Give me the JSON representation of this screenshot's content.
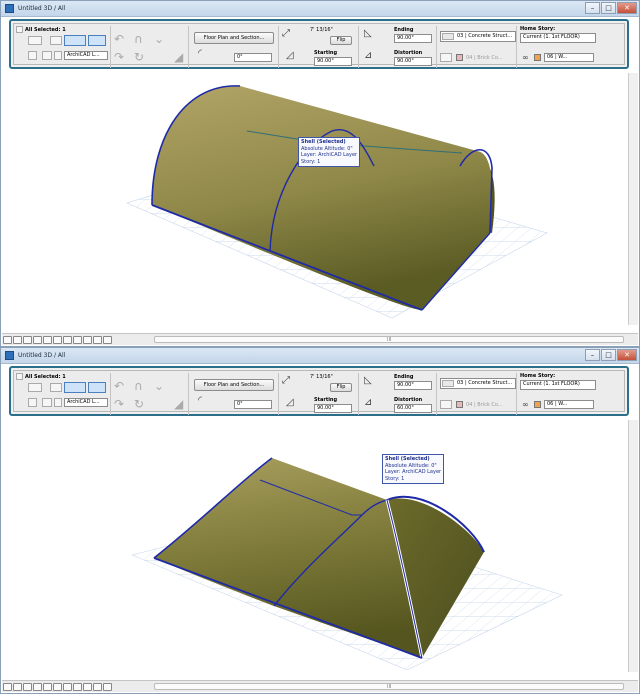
{
  "windows": [
    {
      "title": "Untitled 3D / All",
      "controls": {
        "minimize": "–",
        "maximize": "□",
        "close": "✕"
      },
      "infobox": {
        "selection_label": "All Selected: 1",
        "layer_value": "ArchiCAD L...",
        "plan_button": "Floor Plan and Section...",
        "angle_value": "0°",
        "thickness_value": "7' 13/16\"",
        "flip_button": "Flip",
        "starting_label": "Starting",
        "starting_value": "90.00°",
        "ending_label": "Ending",
        "ending_value": "90.00°",
        "distortion_label": "Distortion",
        "distortion_value": "90.00°",
        "composite": "03 | Concrete Struct...",
        "material": "04 | Brick Co...",
        "material_disabled": true,
        "home_story_label": "Home Story:",
        "home_story_value": "Current (1. 1st FLOOR)",
        "surface": "06 | W..."
      },
      "tooltip": {
        "title": "Shell (Selected)",
        "lines": [
          "Absolute Altitude: 0\"",
          "Layer: ArchiCAD Layer",
          "Story: 1"
        ]
      },
      "scroll_marker": "III"
    },
    {
      "title": "Untitled 3D / All",
      "controls": {
        "minimize": "–",
        "maximize": "□",
        "close": "✕"
      },
      "infobox": {
        "selection_label": "All Selected: 1",
        "layer_value": "ArchiCAD L...",
        "plan_button": "Floor Plan and Section...",
        "angle_value": "0°",
        "thickness_value": "7' 13/16\"",
        "flip_button": "Flip",
        "starting_label": "Starting",
        "starting_value": "90.00°",
        "ending_label": "Ending",
        "ending_value": "90.00°",
        "distortion_label": "Distortion",
        "distortion_value": "60.00°",
        "composite": "03 | Concrete Struct...",
        "material": "04 | Brick Co...",
        "material_disabled": true,
        "home_story_label": "Home Story:",
        "home_story_value": "Current (1. 1st FLOOR)",
        "surface": "06 | W..."
      },
      "tooltip": {
        "title": "Shell (Selected)",
        "lines": [
          "Absolute Altitude: 0\"",
          "Layer: ArchiCAD Layer",
          "Story: 1"
        ]
      },
      "scroll_marker": "III"
    }
  ],
  "colors": {
    "shell_light": "#a39a55",
    "shell_dark": "#585a22",
    "edge": "#1e2aa8",
    "grid": "#b9cde6",
    "infobox_border": "#2c6f8a",
    "tooltip_text": "#1f2f8a"
  },
  "icons": {
    "pointer": "arrow-pointer-icon",
    "geometry": "shell-geometry-icon",
    "eye": "eye-icon",
    "layer": "layer-icon",
    "arc": "arc-icon",
    "angle": "angle-icon",
    "distortion": "distortion-icon",
    "pen": "pen-icon",
    "surface": "surface-icon"
  }
}
